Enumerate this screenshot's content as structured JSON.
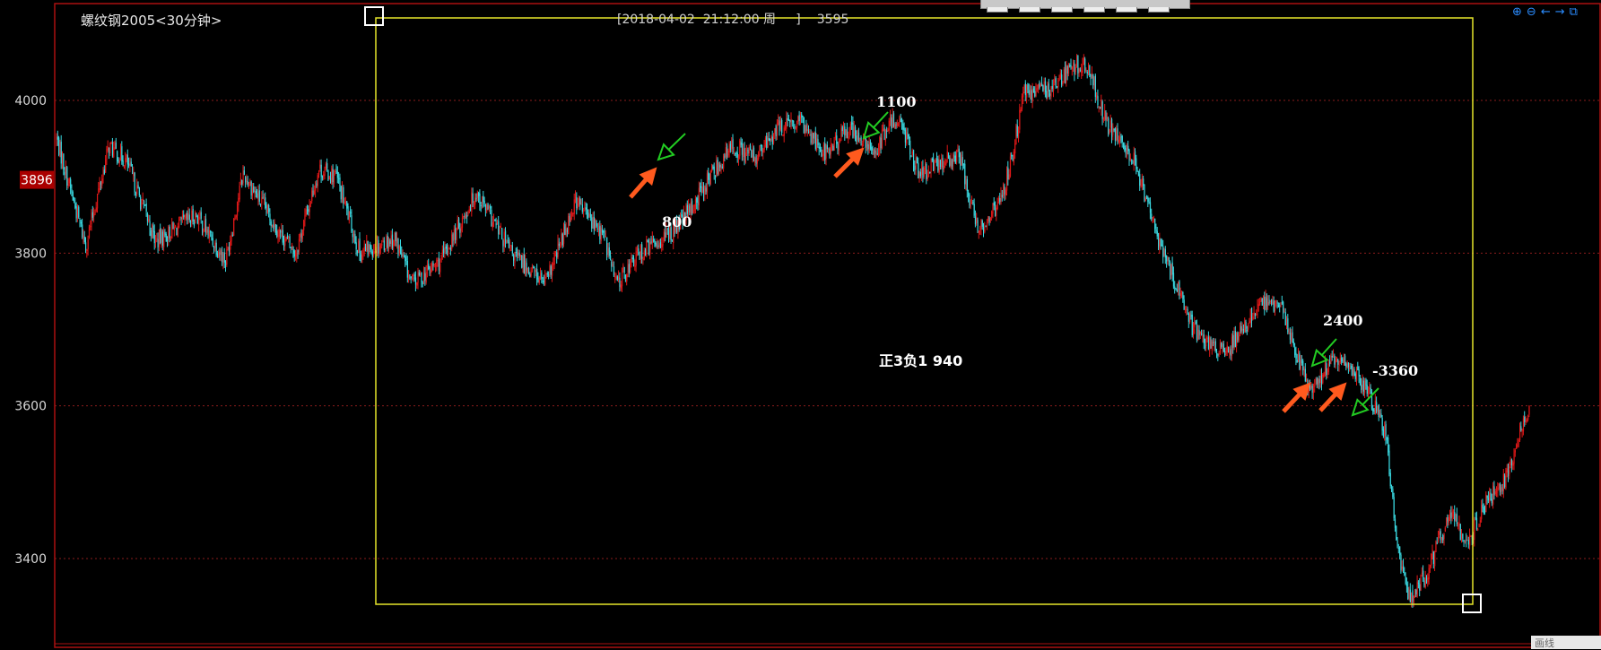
{
  "header": {
    "title": "螺纹钢2005<30分钟>",
    "info_datetime": "[2018-04-02  21:12:00 周     ]",
    "info_price": "3595"
  },
  "current_price_tag": "3896",
  "corner_label": "画线",
  "icons": [
    "zoom-in-icon",
    "zoom-out-icon",
    "arrow-left-icon",
    "arrow-right-icon",
    "restore-icon"
  ],
  "colors": {
    "up": "#e01818",
    "down": "#3ad8e0",
    "border": "#aa1111",
    "box": "#e6e62a",
    "buy_arrow": "#ff5a1e",
    "sell_arrow": "#22cc22"
  },
  "annotations": {
    "a1": "800",
    "a2": "1100",
    "a3": "2400",
    "a4": "-3360",
    "summary": "正3负1 940"
  },
  "chart_data": {
    "type": "candlestick",
    "title": "螺纹钢2005<30分钟>",
    "ylim": [
      3330,
      4115
    ],
    "yticks": [
      4000,
      3800,
      3600,
      3400
    ],
    "grid": "horizontal dotted",
    "anchors": [
      [
        0,
        3950
      ],
      [
        25,
        3810
      ],
      [
        45,
        3940
      ],
      [
        60,
        3920
      ],
      [
        85,
        3815
      ],
      [
        120,
        3850
      ],
      [
        145,
        3790
      ],
      [
        160,
        3905
      ],
      [
        190,
        3830
      ],
      [
        205,
        3800
      ],
      [
        225,
        3910
      ],
      [
        240,
        3900
      ],
      [
        260,
        3800
      ],
      [
        290,
        3820
      ],
      [
        305,
        3760
      ],
      [
        330,
        3790
      ],
      [
        360,
        3880
      ],
      [
        390,
        3800
      ],
      [
        420,
        3760
      ],
      [
        445,
        3870
      ],
      [
        470,
        3820
      ],
      [
        480,
        3760
      ],
      [
        500,
        3800
      ],
      [
        530,
        3830
      ],
      [
        545,
        3860
      ],
      [
        560,
        3900
      ],
      [
        580,
        3940
      ],
      [
        600,
        3925
      ],
      [
        620,
        3965
      ],
      [
        640,
        3970
      ],
      [
        660,
        3930
      ],
      [
        680,
        3965
      ],
      [
        700,
        3930
      ],
      [
        720,
        3980
      ],
      [
        730,
        3950
      ],
      [
        740,
        3900
      ],
      [
        760,
        3920
      ],
      [
        775,
        3925
      ],
      [
        790,
        3830
      ],
      [
        810,
        3870
      ],
      [
        820,
        3930
      ],
      [
        830,
        4010
      ],
      [
        850,
        4015
      ],
      [
        870,
        4040
      ],
      [
        880,
        4050
      ],
      [
        890,
        4020
      ],
      [
        900,
        3970
      ],
      [
        925,
        3920
      ],
      [
        940,
        3840
      ],
      [
        960,
        3760
      ],
      [
        975,
        3700
      ],
      [
        990,
        3680
      ],
      [
        1005,
        3670
      ],
      [
        1015,
        3700
      ],
      [
        1035,
        3735
      ],
      [
        1050,
        3730
      ],
      [
        1075,
        3620
      ],
      [
        1085,
        3640
      ],
      [
        1095,
        3660
      ],
      [
        1110,
        3650
      ],
      [
        1125,
        3620
      ],
      [
        1140,
        3560
      ],
      [
        1150,
        3410
      ],
      [
        1160,
        3350
      ],
      [
        1175,
        3380
      ],
      [
        1195,
        3460
      ],
      [
        1210,
        3420
      ],
      [
        1225,
        3470
      ],
      [
        1245,
        3510
      ],
      [
        1255,
        3570
      ],
      [
        1263,
        3595
      ]
    ],
    "annotations": [
      {
        "label": "800",
        "bar": 655
      },
      {
        "label": "1100",
        "bar": 665
      },
      {
        "label": "2400",
        "bar": 1100
      },
      {
        "label": "-3360",
        "bar": 1138
      },
      {
        "label": "正3负1 940"
      }
    ]
  }
}
